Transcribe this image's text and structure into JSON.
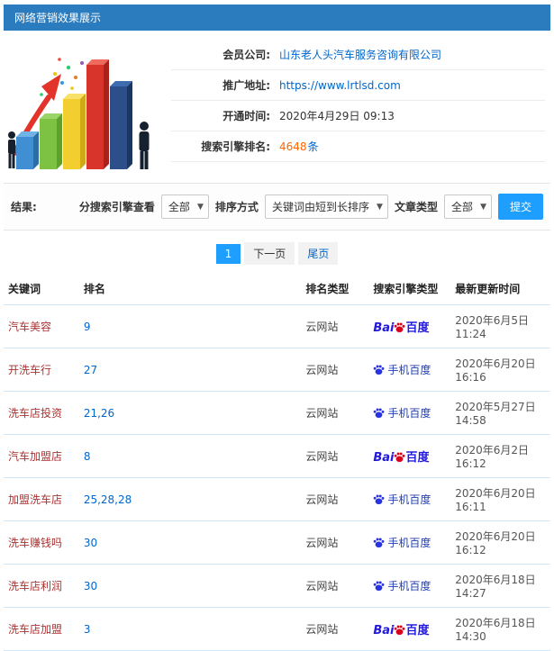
{
  "header": {
    "title": "网络营销效果展示"
  },
  "info": {
    "company_label": "会员公司:",
    "company_value": "山东老人头汽车服务咨询有限公司",
    "url_label": "推广地址:",
    "url_value": "https://www.lrtlsd.com",
    "open_label": "开通时间:",
    "open_value": "2020年4月29日 09:13",
    "rank_label": "搜索引擎排名:",
    "rank_count": "4648",
    "rank_unit": "条"
  },
  "filters": {
    "result_label": "结果:",
    "engine_label": "分搜索引擎查看",
    "engine_value": "全部",
    "sort_label": "排序方式",
    "sort_value": "关键词由短到长排序",
    "type_label": "文章类型",
    "type_value": "全部",
    "submit_label": "提交"
  },
  "pagination": {
    "current": "1",
    "next": "下一页",
    "last": "尾页"
  },
  "table": {
    "headers": [
      "关键词",
      "排名",
      "排名类型",
      "搜索引擎类型",
      "最新更新时间"
    ],
    "engine_labels": {
      "baidu_prefix": "Bai",
      "baidu_suffix": "百度",
      "mobile": "手机百度"
    },
    "rows": [
      {
        "keyword": "汽车美容",
        "rank": "9",
        "rank_type": "云网站",
        "engine": "baidu",
        "time": "2020年6月5日 11:24"
      },
      {
        "keyword": "开洗车行",
        "rank": "27",
        "rank_type": "云网站",
        "engine": "mobile",
        "time": "2020年6月20日 16:16"
      },
      {
        "keyword": "洗车店投资",
        "rank": "21,26",
        "rank_type": "云网站",
        "engine": "mobile",
        "time": "2020年5月27日 14:58"
      },
      {
        "keyword": "汽车加盟店",
        "rank": "8",
        "rank_type": "云网站",
        "engine": "baidu",
        "time": "2020年6月2日 16:12"
      },
      {
        "keyword": "加盟洗车店",
        "rank": "25,28,28",
        "rank_type": "云网站",
        "engine": "mobile",
        "time": "2020年6月20日 16:11"
      },
      {
        "keyword": "洗车赚钱吗",
        "rank": "30",
        "rank_type": "云网站",
        "engine": "mobile",
        "time": "2020年6月20日 16:12"
      },
      {
        "keyword": "洗车店利润",
        "rank": "30",
        "rank_type": "云网站",
        "engine": "mobile",
        "time": "2020年6月18日 14:27"
      },
      {
        "keyword": "洗车店加盟",
        "rank": "3",
        "rank_type": "云网站",
        "engine": "baidu",
        "time": "2020年6月18日 14:30"
      }
    ]
  },
  "colors": {
    "header_bg": "#2b7cbe",
    "link": "#0066cc",
    "highlight": "#ff6600",
    "button": "#1e9fff",
    "keyword": "#aa3333",
    "baidu_blue": "#2319dc",
    "baidu_red": "#d9001b",
    "mobile_baidu_blue": "#2932e1",
    "table_border": "#cfe7f8"
  }
}
